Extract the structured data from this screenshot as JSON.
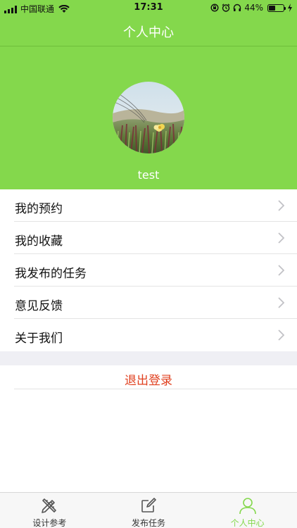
{
  "status_bar": {
    "carrier": "中国联通",
    "time": "17:31",
    "battery_percent": "44%",
    "battery_level": 0.44,
    "icons": [
      "signal-icon",
      "wifi-icon",
      "orientation-lock-icon",
      "alarm-icon",
      "headphones-icon",
      "battery-icon",
      "charging-icon"
    ]
  },
  "nav": {
    "title": "个人中心"
  },
  "profile": {
    "username": "test",
    "avatar": "avatar-photo"
  },
  "menu": {
    "items": [
      {
        "label": "我的预约"
      },
      {
        "label": "我的收藏"
      },
      {
        "label": "我发布的任务"
      },
      {
        "label": "意见反馈"
      },
      {
        "label": "关于我们"
      }
    ],
    "chevron_icon": "chevron-right-icon"
  },
  "logout": {
    "label": "退出登录"
  },
  "tabbar": {
    "tabs": [
      {
        "label": "设计参考",
        "icon": "pencil-ruler-icon",
        "active": false
      },
      {
        "label": "发布任务",
        "icon": "edit-icon",
        "active": false
      },
      {
        "label": "个人中心",
        "icon": "person-icon",
        "active": true
      }
    ]
  },
  "colors": {
    "primary": "#84d84c",
    "danger": "#e0401f",
    "background": "#ffffff",
    "separator_band": "#efeff4",
    "tab_inactive": "#555555"
  }
}
